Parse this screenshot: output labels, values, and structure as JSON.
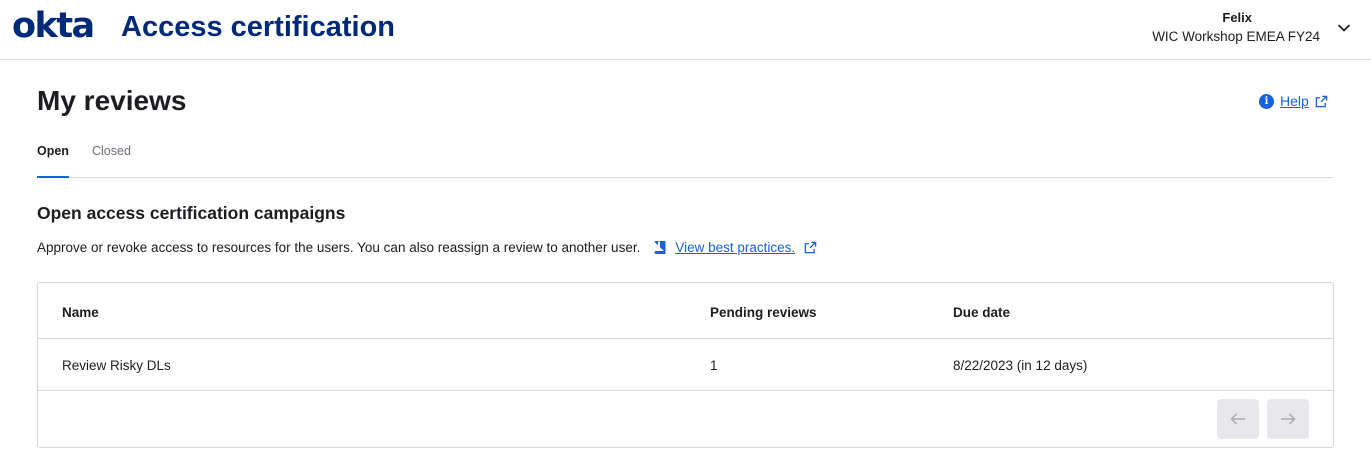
{
  "header": {
    "logo": "okta",
    "app_title": "Access certification",
    "user_name": "Felix",
    "user_org": "WIC Workshop EMEA FY24"
  },
  "page": {
    "title": "My reviews",
    "help_label": "Help"
  },
  "tabs": [
    {
      "label": "Open",
      "active": true
    },
    {
      "label": "Closed",
      "active": false
    }
  ],
  "section": {
    "title": "Open access certification campaigns",
    "description": "Approve or revoke access to resources for the users. You can also reassign a review to another user.",
    "best_practices_link": "View best practices."
  },
  "table": {
    "columns": [
      "Name",
      "Pending reviews",
      "Due date"
    ],
    "rows": [
      [
        "Review Risky DLs",
        "1",
        "8/22/2023 (in 12 days)"
      ]
    ]
  },
  "pager": {
    "prev_icon": "arrow-left-icon",
    "next_icon": "arrow-right-icon"
  },
  "colors": {
    "brand": "#00297a",
    "link": "#1662dd",
    "border": "#d7d7dc"
  }
}
